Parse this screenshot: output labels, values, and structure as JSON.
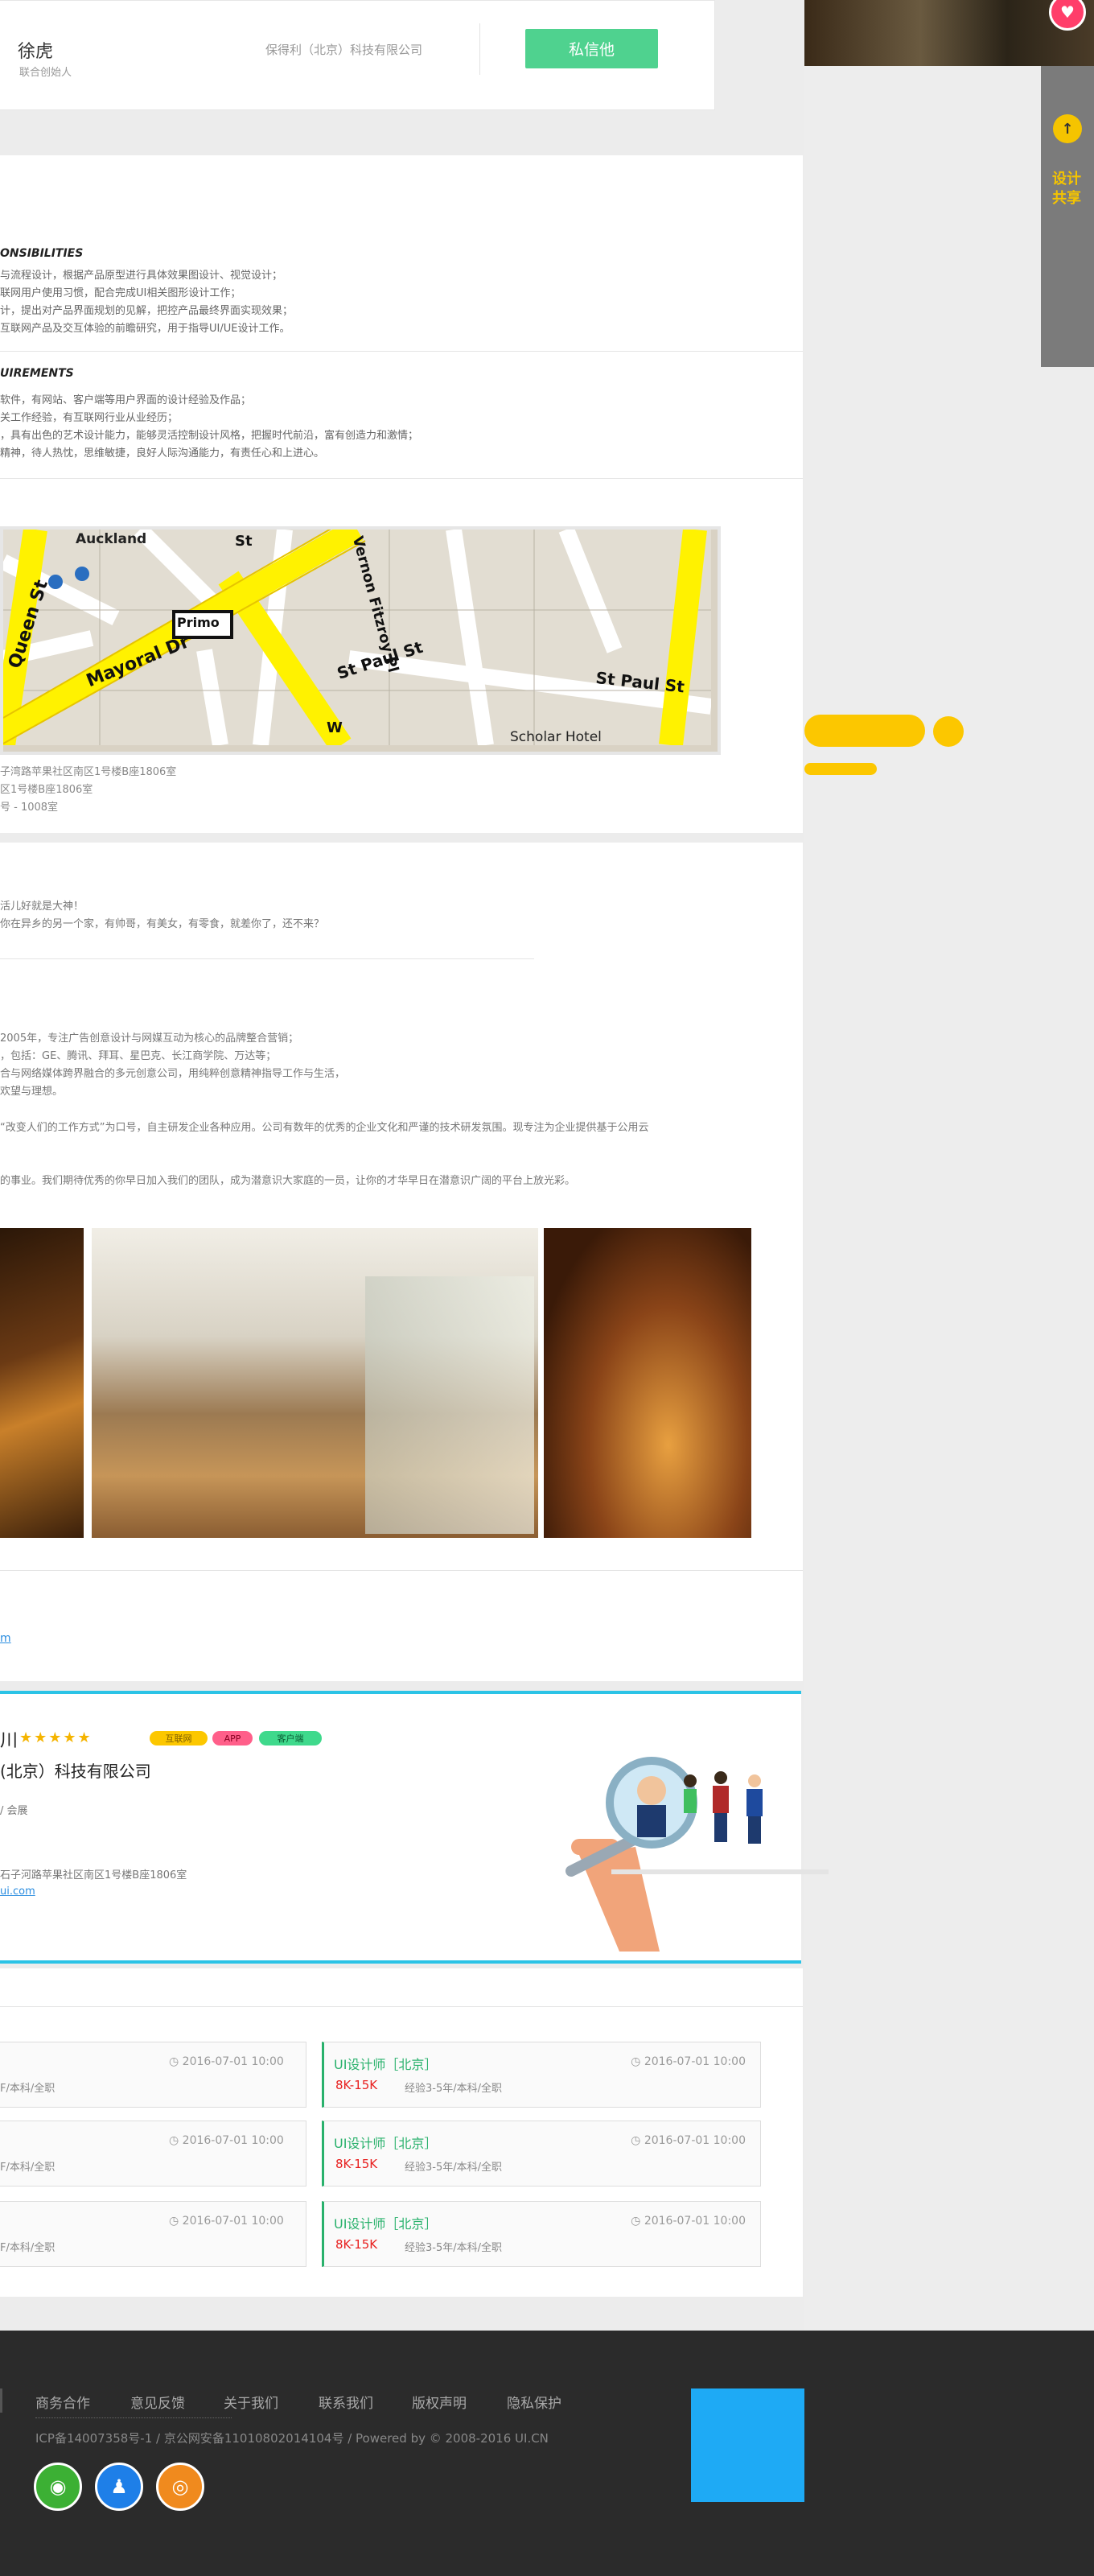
{
  "contact": {
    "name": "徐虎",
    "role": "联合创始人",
    "company": "保得利（北京）科技有限公司",
    "message_button": "私信他"
  },
  "rail": {
    "top_icon": "arrow-up-icon",
    "promo_text_1": "设计",
    "promo_text_2": "共享"
  },
  "job_desc": {
    "responsibilities_title": "ONSIBILITIES",
    "responsibilities": [
      "与流程设计，根据产品原型进行具体效果图设计、视觉设计；",
      "联网用户使用习惯，配合完成UI相关图形设计工作；",
      "计，提出对产品界面规划的见解，把控产品最终界面实现效果；",
      "互联网产品及交互体验的前瞻研究，用于指导UI/UE设计工作。"
    ],
    "requirements_title": "UIREMENTS",
    "requirements": [
      "软件，有网站、客户端等用户界面的设计经验及作品；",
      "关工作经验，有互联网行业从业经历；",
      "，具有出色的艺术设计能力，能够灵活控制设计风格，把握时代前沿，富有创造力和激情；",
      "精神，待人热忱，思维敏捷，良好人际沟通能力，有责任心和上进心。"
    ]
  },
  "map": {
    "labels": [
      "Auckland",
      "Queen St",
      "Mayoral Dr",
      "Primo",
      "Vernon Fitzroy Pl",
      "St Paul St",
      "St Paul St",
      "Scholar Hotel",
      "St",
      "W"
    ],
    "addresses": [
      "子湾路苹果社区南区1号楼B座1806室",
      "区1号楼B座1806室",
      "号 - 1008室"
    ]
  },
  "about": {
    "intro": [
      "活儿好就是大神！",
      "你在异乡的另一个家，有帅哥，有美女，有零食，就差你了，还不来？"
    ],
    "history": [
      "2005年，专注广告创意设计与网媒互动为核心的品牌整合营销；",
      "，包括：GE、腾讯、拜耳、星巴克、长江商学院、万达等；",
      "合与网络媒体跨界融合的多元创意公司，用纯粹创意精神指导工作与生活，",
      "欢望与理想。"
    ],
    "mission": "“改变人们的工作方式”为口号，自主研发企业各种应用。公司有数年的优秀的企业文化和严谨的技术研发氛围。现专注为企业提供基于公用云",
    "invite": "的事业。我们期待优秀的你早日加入我们的团队，成为潜意识大家庭的一员，让你的才华早日在潜意识广阔的平台上放光彩。",
    "link": "m"
  },
  "company": {
    "name_fragment": "川",
    "stars": "★★★★★",
    "tags": [
      "互联网",
      "APP",
      "客户端"
    ],
    "full_name": "(北京）科技有限公司",
    "industry": "/ 会展",
    "address": "石子河路苹果社区南区1号楼B座1806室",
    "website": "ui.com"
  },
  "jobs": {
    "left": [
      {
        "req": "F/本科/全职",
        "date": "2016-07-01 10:00"
      },
      {
        "req": "F/本科/全职",
        "date": "2016-07-01 10:00"
      },
      {
        "req": "F/本科/全职",
        "date": "2016-07-01 10:00"
      }
    ],
    "right": [
      {
        "title": "UI设计师［北京］",
        "salary": "8K-15K",
        "req": "经验3-5年/本科/全职",
        "date": "2016-07-01 10:00"
      },
      {
        "title": "UI设计师［北京］",
        "salary": "8K-15K",
        "req": "经验3-5年/本科/全职",
        "date": "2016-07-01 10:00"
      },
      {
        "title": "UI设计师［北京］",
        "salary": "8K-15K",
        "req": "经验3-5年/本科/全职",
        "date": "2016-07-01 10:00"
      }
    ]
  },
  "footer": {
    "links": [
      "商务合作",
      "意见反馈",
      "关于我们",
      "联系我们",
      "版权声明",
      "隐私保护"
    ],
    "copyright": "ICP备14007358号-1 / 京公网安备11010802014104号 / Powered by © 2008-2016 UI.CN",
    "social": [
      "wechat-icon",
      "qq-icon",
      "weibo-icon"
    ]
  },
  "colors": {
    "accent_green": "#4fd28f",
    "cyan": "#2bc3e6",
    "yellow": "#fcc700",
    "salary_red": "#e8201f",
    "footer_bg": "#2b2b2b",
    "blue_square": "#1eaaf5"
  }
}
